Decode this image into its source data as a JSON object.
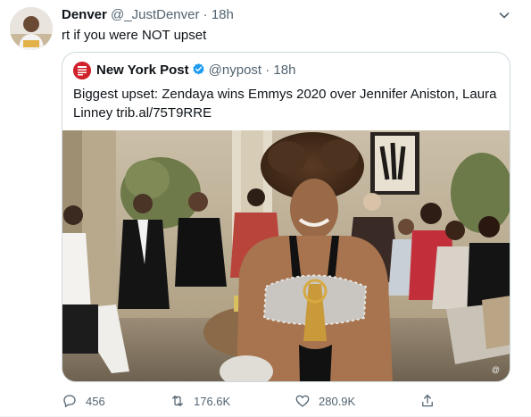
{
  "tweet": {
    "author_name": "Denver",
    "author_handle": "@_JustDenver",
    "separator": "·",
    "time": "18h",
    "text": "rt if you were NOT upset",
    "avatar_icon": "profile-photo",
    "more_icon": "chevron-down-icon"
  },
  "quote": {
    "author_name": "New York Post",
    "author_handle": "@nypost",
    "separator": "·",
    "time": "18h",
    "text": "Biggest upset: Zendaya wins Emmys 2020 over Jennifer Aniston, Laura Linney trib.al/75T9RRE",
    "verified_icon": "verified-badge-icon",
    "verified_color": "#1d9bf0",
    "logo_color": "#d1222b",
    "media_icon": "video-thumbnail"
  },
  "actions": {
    "reply_count": "456",
    "retweet_count": "176.6K",
    "like_count": "280.9K",
    "reply_icon": "reply-icon",
    "retweet_icon": "retweet-icon",
    "like_icon": "heart-icon",
    "share_icon": "share-icon"
  },
  "colors": {
    "text_primary": "#0f1419",
    "text_secondary": "#536471",
    "border": "#cfd9de"
  }
}
